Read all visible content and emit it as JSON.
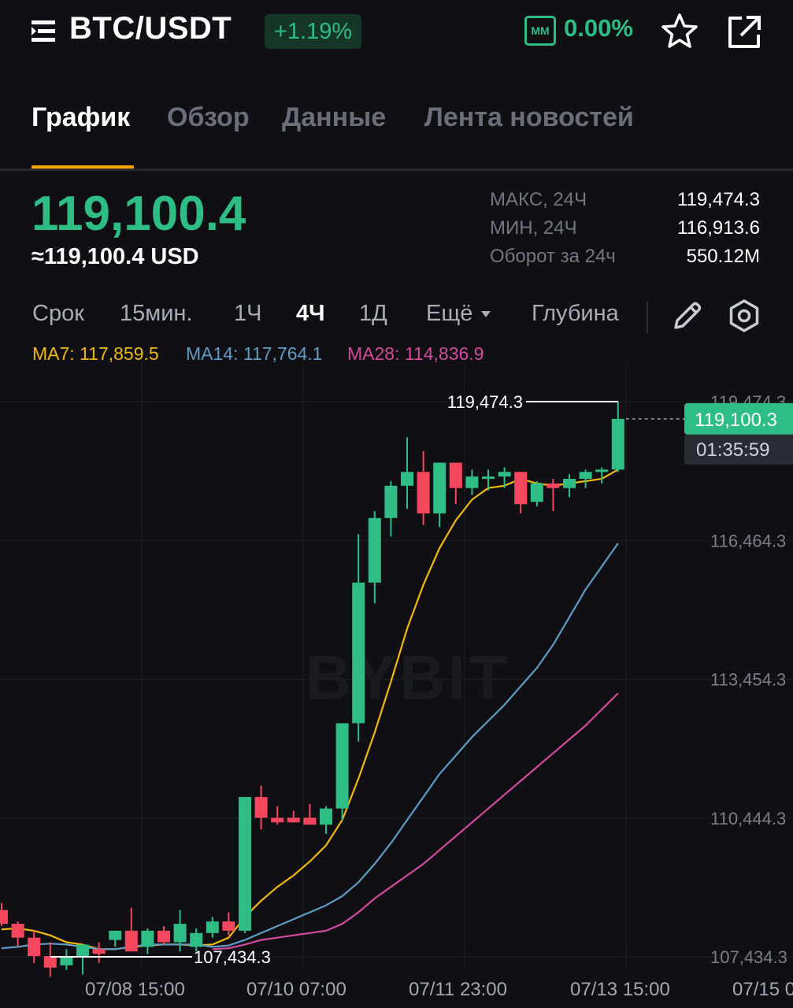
{
  "header": {
    "pair": "BTC/USDT",
    "change": "+1.19%",
    "mm_badge": "MM",
    "mm_value": "0.00%",
    "icons": [
      "menu-icon",
      "star-icon",
      "share-icon"
    ]
  },
  "tabs": [
    {
      "label": "График",
      "active": true
    },
    {
      "label": "Обзор",
      "active": false
    },
    {
      "label": "Данные",
      "active": false
    },
    {
      "label": "Лента новостей",
      "active": false
    }
  ],
  "price": {
    "last": "119,100.4",
    "usd": "≈119,100.4 USD",
    "stats": [
      {
        "label": "МАКС, 24Ч",
        "value": "119,474.3"
      },
      {
        "label": "МИН, 24Ч",
        "value": "116,913.6"
      },
      {
        "label": "Оборот за 24ч",
        "value": "550.12M"
      }
    ]
  },
  "intervals": {
    "items": [
      {
        "label": "Срок",
        "active": false
      },
      {
        "label": "15мин.",
        "active": false
      },
      {
        "label": "1Ч",
        "active": false
      },
      {
        "label": "4Ч",
        "active": true
      },
      {
        "label": "1Д",
        "active": false
      },
      {
        "label": "Ещё",
        "active": false
      },
      {
        "label": "Глубина",
        "active": false
      }
    ],
    "icons": [
      "pencil-icon",
      "settings-icon",
      "caret-down-icon"
    ]
  },
  "ma": [
    {
      "label": "MA7: 117,859.5",
      "color": "#f0b90b"
    },
    {
      "label": "MA14: 117,764.1",
      "color": "#5e9cc6"
    },
    {
      "label": "MA28: 114,836.9",
      "color": "#d24a9e"
    }
  ],
  "colors": {
    "up": "#2ebd85",
    "down": "#f6465d",
    "accent": "#f7a600",
    "background": "#101014"
  },
  "chart_data": {
    "type": "candlestick",
    "interval": "4Ч",
    "y_ticks": [
      "119,474.3",
      "116,464.3",
      "113,454.3",
      "110,444.3",
      "107,434.3"
    ],
    "x_ticks": [
      "07/08 15:00",
      "07/10 07:00",
      "07/11 23:00",
      "07/13 15:00",
      "07/15 0"
    ],
    "ylim": [
      107434.3,
      119474.3
    ],
    "high_annotation": "119,474.3",
    "low_annotation": "107,434.3",
    "last_price_tag": "119,100.3",
    "countdown": "01:35:59",
    "watermark": "BYBIT",
    "candles": [
      {
        "o": 108450,
        "h": 108600,
        "l": 108100,
        "c": 108150
      },
      {
        "o": 108150,
        "h": 108200,
        "l": 107650,
        "c": 107850
      },
      {
        "o": 107850,
        "h": 108000,
        "l": 107300,
        "c": 107450
      },
      {
        "o": 107450,
        "h": 107750,
        "l": 107000,
        "c": 107200
      },
      {
        "o": 107250,
        "h": 107600,
        "l": 107150,
        "c": 107450
      },
      {
        "o": 107450,
        "h": 107650,
        "l": 107050,
        "c": 107700
      },
      {
        "o": 107600,
        "h": 107750,
        "l": 107300,
        "c": 107500
      },
      {
        "o": 107800,
        "h": 108000,
        "l": 107650,
        "c": 108000
      },
      {
        "o": 108000,
        "h": 108500,
        "l": 107800,
        "c": 107550
      },
      {
        "o": 107650,
        "h": 108050,
        "l": 107500,
        "c": 108000
      },
      {
        "o": 108000,
        "h": 108100,
        "l": 107700,
        "c": 107750
      },
      {
        "o": 107750,
        "h": 108450,
        "l": 107550,
        "c": 108150
      },
      {
        "o": 107650,
        "h": 108050,
        "l": 107550,
        "c": 107950
      },
      {
        "o": 107950,
        "h": 108300,
        "l": 107850,
        "c": 108200
      },
      {
        "o": 108200,
        "h": 108400,
        "l": 107900,
        "c": 108000
      },
      {
        "o": 108000,
        "h": 108850,
        "l": 107950,
        "c": 110900
      },
      {
        "o": 110900,
        "h": 111150,
        "l": 110200,
        "c": 110450
      },
      {
        "o": 110450,
        "h": 110700,
        "l": 110300,
        "c": 110350
      },
      {
        "o": 110450,
        "h": 110600,
        "l": 110350,
        "c": 110350
      },
      {
        "o": 110450,
        "h": 110750,
        "l": 110300,
        "c": 110300
      },
      {
        "o": 110300,
        "h": 110700,
        "l": 110100,
        "c": 110650
      },
      {
        "o": 110650,
        "h": 112350,
        "l": 110400,
        "c": 112500
      },
      {
        "o": 112500,
        "h": 116600,
        "l": 112100,
        "c": 115550
      },
      {
        "o": 115550,
        "h": 117100,
        "l": 115100,
        "c": 116950
      },
      {
        "o": 116950,
        "h": 117750,
        "l": 116550,
        "c": 117650
      },
      {
        "o": 117650,
        "h": 118700,
        "l": 117150,
        "c": 117950
      },
      {
        "o": 117950,
        "h": 118400,
        "l": 116800,
        "c": 117050
      },
      {
        "o": 117050,
        "h": 118050,
        "l": 116750,
        "c": 118150
      },
      {
        "o": 118150,
        "h": 118050,
        "l": 117250,
        "c": 117600
      },
      {
        "o": 117600,
        "h": 118000,
        "l": 117450,
        "c": 117850
      },
      {
        "o": 117850,
        "h": 118000,
        "l": 117550,
        "c": 117850
      },
      {
        "o": 117850,
        "h": 118050,
        "l": 117600,
        "c": 117950
      },
      {
        "o": 117950,
        "h": 117950,
        "l": 117050,
        "c": 117250
      },
      {
        "o": 117300,
        "h": 117750,
        "l": 117200,
        "c": 117700
      },
      {
        "o": 117700,
        "h": 117800,
        "l": 117100,
        "c": 117600
      },
      {
        "o": 117600,
        "h": 117900,
        "l": 117400,
        "c": 117800
      },
      {
        "o": 117800,
        "h": 118000,
        "l": 117600,
        "c": 117950
      },
      {
        "o": 117950,
        "h": 118050,
        "l": 117700,
        "c": 118000
      },
      {
        "o": 118000,
        "h": 119474.3,
        "l": 117950,
        "c": 119100.3
      }
    ],
    "series": [
      {
        "name": "MA7",
        "values": [
          108030,
          108050,
          108000,
          107900,
          107750,
          107700,
          107600,
          107600,
          107650,
          107680,
          107700,
          107700,
          107680,
          107700,
          107850,
          108300,
          108650,
          108950,
          109200,
          109500,
          109850,
          110400,
          111300,
          112300,
          113400,
          114550,
          115500,
          116300,
          116900,
          117350,
          117600,
          117650,
          117800,
          117700,
          117650,
          117700,
          117750,
          117800,
          118000
        ]
      },
      {
        "name": "MA14",
        "values": [
          107620,
          107650,
          107700,
          107720,
          107700,
          107650,
          107600,
          107600,
          107650,
          107700,
          107700,
          107700,
          107700,
          107650,
          107680,
          107800,
          107950,
          108100,
          108250,
          108400,
          108550,
          108750,
          109050,
          109450,
          109900,
          110400,
          110900,
          111400,
          111800,
          112200,
          112550,
          112900,
          113300,
          113700,
          114200,
          114800,
          115400,
          115900,
          116400
        ]
      },
      {
        "name": "MA28",
        "values": [
          null,
          null,
          null,
          null,
          null,
          null,
          null,
          null,
          null,
          null,
          null,
          null,
          null,
          107600,
          107620,
          107700,
          107800,
          107850,
          107900,
          107950,
          108000,
          108150,
          108400,
          108700,
          108950,
          109200,
          109450,
          109750,
          110050,
          110350,
          110650,
          110950,
          111250,
          111550,
          111850,
          112150,
          112450,
          112800,
          113150
        ]
      }
    ]
  }
}
